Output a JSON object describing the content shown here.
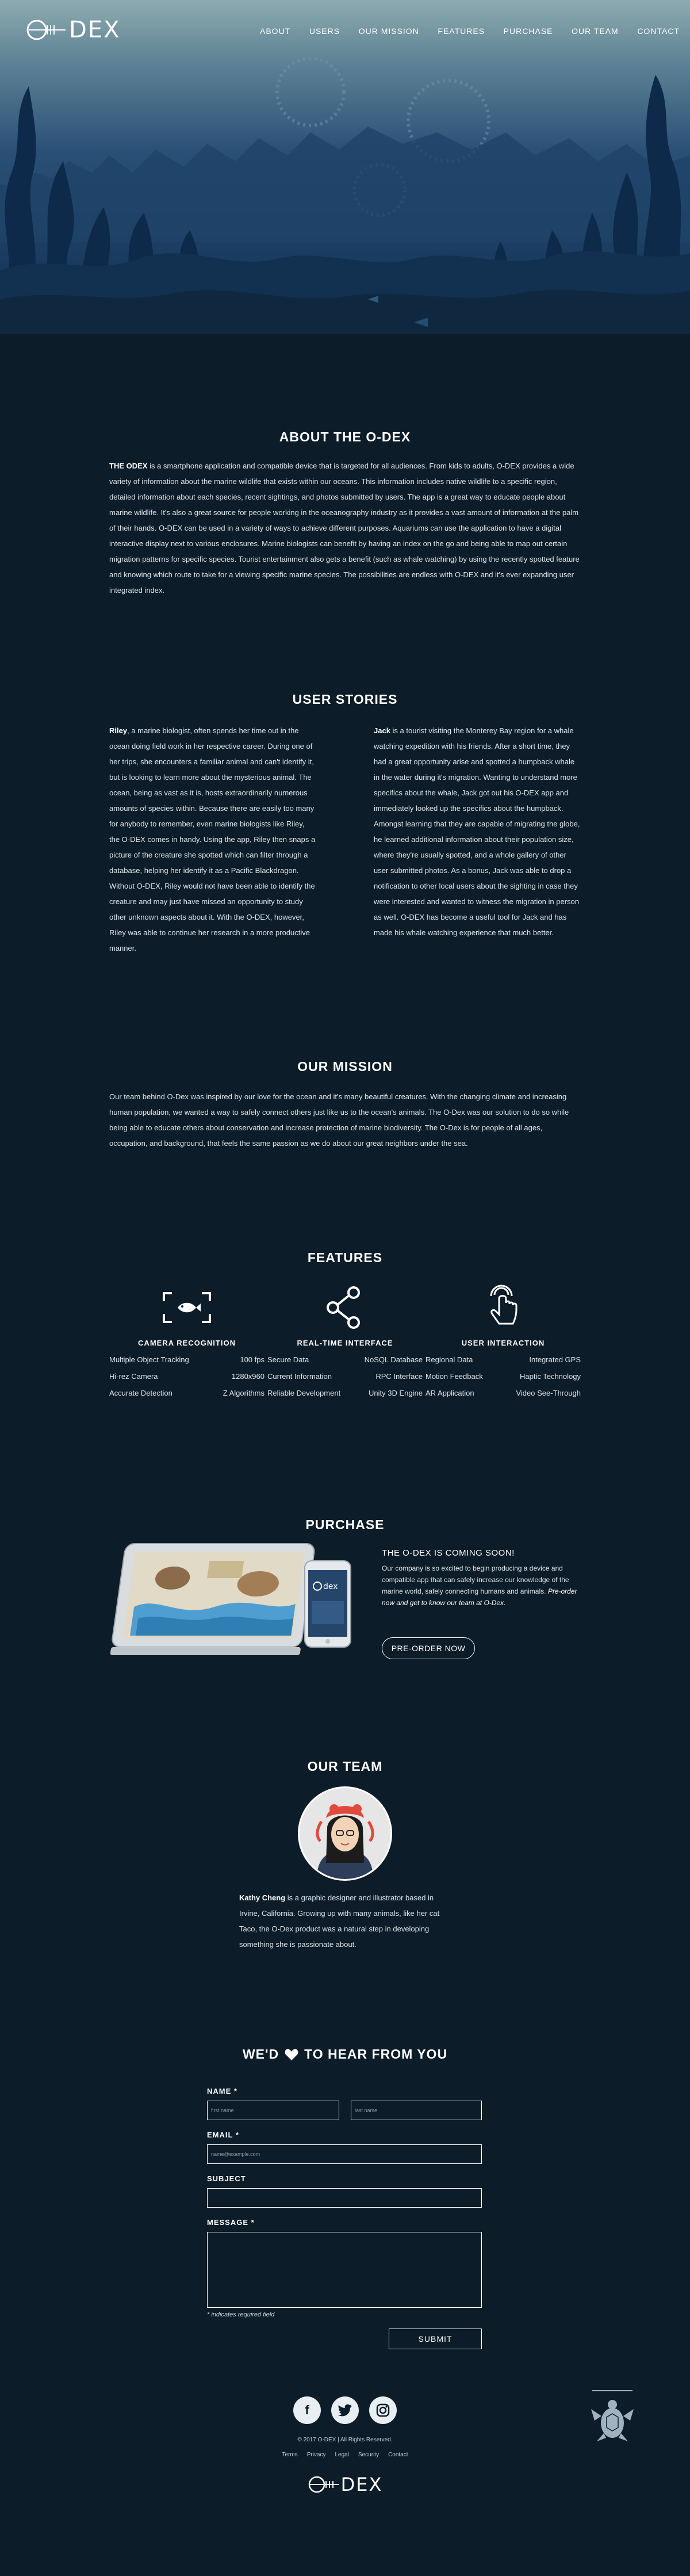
{
  "brand": {
    "logo_text": "DEX"
  },
  "nav": {
    "items": [
      {
        "label": "ABOUT"
      },
      {
        "label": "USERS"
      },
      {
        "label": "OUR MISSION"
      },
      {
        "label": "FEATURES"
      },
      {
        "label": "PURCHASE"
      },
      {
        "label": "OUR TEAM"
      },
      {
        "label": "CONTACT"
      }
    ]
  },
  "about": {
    "title": "ABOUT THE O-DEX",
    "lead": "THE ODEX",
    "body": " is a smartphone application and compatible device that is targeted for all audiences. From kids to adults, O-DEX provides a wide variety of information about the marine wildlife that exists within our oceans. This information includes native wildlife to a specific region, detailed information about each species, recent sightings, and photos submitted by users. The app is a great way to educate people about marine wildlife. It's also a great source for people working in the oceanography industry as it provides a vast amount of information at the palm of their hands. O-DEX can be used in a variety of ways to achieve different purposes. Aquariums can use the application to have a digital interactive display next to various enclosures. Marine biologists can benefit by having an index on the go and being able to map out certain migration patterns for specific species. Tourist entertainment also gets a benefit (such as whale watching) by using the recently spotted feature and knowing which route to take for a viewing specific marine species. The possibilities are endless with O-DEX and it's ever expanding user integrated index."
  },
  "user_stories": {
    "title": "USER STORIES",
    "riley": {
      "name": "Riley",
      "body": ", a marine biologist, often spends her time out in the ocean doing field work in her respective career. During one of her trips, she encounters a familiar animal and can't identify it, but is looking to learn more about the mysterious animal. The ocean, being as vast as it is, hosts extraordinarily numerous amounts of species within. Because there are easily too many for anybody to remember, even marine biologists like Riley, the O-DEX comes in handy. Using the app, Riley then snaps a picture of the creature she spotted which can filter through a database, helping her identify it as a Pacific Blackdragon. Without O-DEX, Riley would not have been able to identify the creature and may just have missed an opportunity to study other unknown aspects about it. With the O-DEX, however, Riley was able to continue her research in a more productive manner."
    },
    "jack": {
      "name": "Jack",
      "body": " is a tourist visiting the Monterey Bay region for a whale watching expedition with his friends. After a short time, they had a great opportunity arise and spotted a humpback whale in the water during it's migration. Wanting to understand more specifics about the whale, Jack got out his O-DEX app and immediately looked up the specifics about the humpback. Amongst learning that they are capable of migrating the globe, he learned additional information about their population size, where they're usually spotted, and a whole gallery of other user submitted photos. As a bonus, Jack was able to drop a notification to other local users about the sighting in case they were interested and wanted to witness the migration in person as well. O-DEX has become a useful tool for Jack and has made his whale watching experience that much better."
    }
  },
  "mission": {
    "title": "OUR MISSION",
    "body": "Our team behind O-Dex was inspired by our love for the ocean and it's many beautiful creatures. With the changing climate and increasing human population, we wanted a way to safely connect others just like us to the ocean's animals. The O-Dex was our solution to do so while being able to educate others about conservation and increase protection of marine biodiversity. The O-Dex is for people of all ages, occupation, and background, that feels the same passion as we do about our great neighbors under the sea."
  },
  "features": {
    "title": "FEATURES",
    "items": [
      {
        "icon": "camera-fish-icon",
        "title": "CAMERA RECOGNITION",
        "rows": [
          [
            "Multiple Object Tracking",
            "100 fps"
          ],
          [
            "Hi-rez Camera",
            "1280x960"
          ],
          [
            "Accurate Detection",
            "Z Algorithms"
          ]
        ]
      },
      {
        "icon": "share-icon",
        "title": "REAL-TIME INTERFACE",
        "rows": [
          [
            "Secure Data",
            "NoSQL Database"
          ],
          [
            "Current Information",
            "RPC Interface"
          ],
          [
            "Reliable Development",
            "Unity 3D Engine"
          ]
        ]
      },
      {
        "icon": "touch-icon",
        "title": "USER INTERACTION",
        "rows": [
          [
            "Regional Data",
            "Integrated GPS"
          ],
          [
            "Motion Feedback",
            "Haptic Technology"
          ],
          [
            "AR Application",
            "Video See-Through"
          ]
        ]
      }
    ]
  },
  "purchase": {
    "title": "PURCHASE",
    "heading": "THE O-DEX IS COMING SOON!",
    "body": "Our company is so excited to begin producing a device and compatible app that can safely increase our knowledge of the marine world, safely connecting humans and animals.",
    "italic": "Pre-order now and get to know our team at O-Dex.",
    "button": "PRE-ORDER NOW",
    "phone_logo": "dex"
  },
  "team": {
    "title": "OUR TEAM",
    "name": "Kathy Cheng",
    "bio": " is a graphic designer and illustrator based in Irvine, California. Growing up with many animals, like her cat Taco, the O-Dex product was a natural step in developing something she is passionate about."
  },
  "contact": {
    "title_pre": "WE'D",
    "title_post": "TO HEAR FROM YOU",
    "name_label": "NAME *",
    "first_placeholder": "first name",
    "last_placeholder": "last name",
    "email_label": "EMAIL *",
    "email_placeholder": "name@example.com",
    "subject_label": "SUBJECT",
    "message_label": "MESSAGE *",
    "required_note": "* indicates required field",
    "submit": "SUBMIT"
  },
  "footer": {
    "social": [
      {
        "icon": "facebook-icon",
        "glyph": "f"
      },
      {
        "icon": "twitter-icon",
        "glyph": "t"
      },
      {
        "icon": "instagram-icon",
        "glyph": "◎"
      }
    ],
    "copyright": "© 2017 O-DEX | All Rights Reserved.",
    "links": [
      "Terms",
      "Privacy",
      "Legal",
      "Security",
      "Contact"
    ],
    "logo_text": "DEX"
  },
  "colors": {
    "background": "#0c1c28",
    "hero_top": "#8aa8ad",
    "hero_mid": "#2d5578",
    "seaweed": "#0e2a4a",
    "accent_red": "#e04a3c"
  }
}
